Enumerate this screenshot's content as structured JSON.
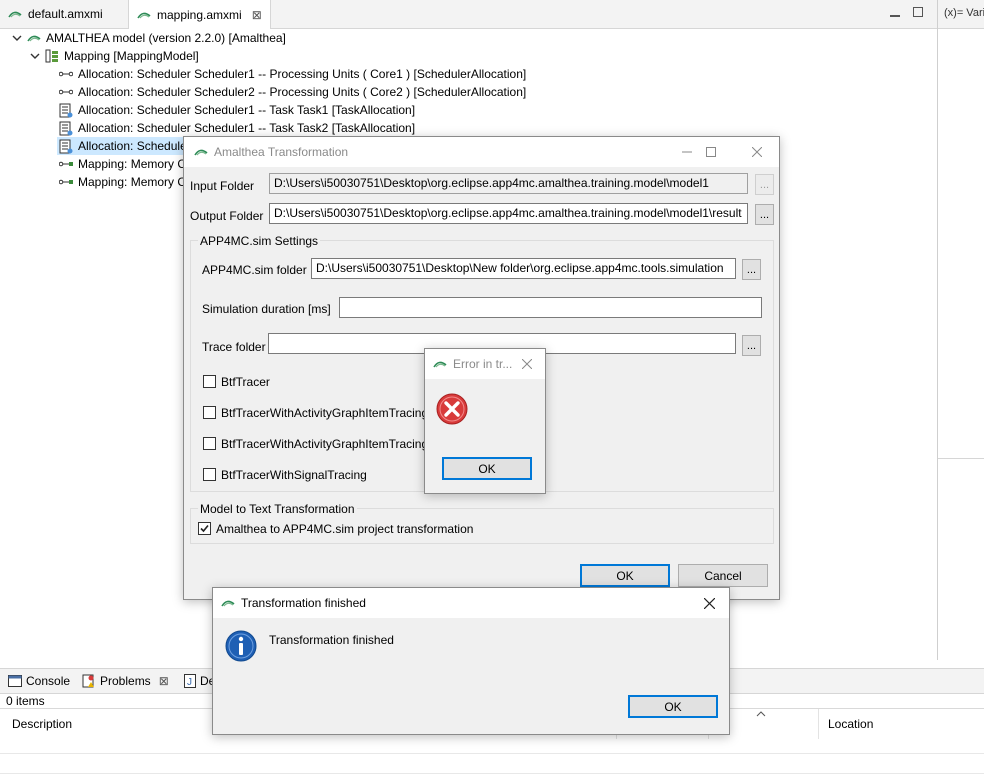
{
  "editor": {
    "tabs": [
      {
        "label": "default.amxmi"
      },
      {
        "label": "mapping.amxmi",
        "close": "⊠"
      }
    ],
    "right_tab_label": "(x)= Varia"
  },
  "tree": {
    "root": "AMALTHEA model (version 2.2.0) [Amalthea]",
    "mapping": "Mapping [MappingModel]",
    "items": [
      {
        "label": "Allocation: Scheduler Scheduler1 -- Processing Units ( Core1 ) [SchedulerAllocation]",
        "icon": "scheduler-allocation-icon"
      },
      {
        "label": "Allocation: Scheduler Scheduler2 -- Processing Units ( Core2 ) [SchedulerAllocation]",
        "icon": "scheduler-allocation-icon"
      },
      {
        "label": "Allocation: Scheduler Scheduler1 -- Task Task1 [TaskAllocation]",
        "icon": "task-allocation-icon"
      },
      {
        "label": "Allocation: Scheduler Scheduler1 -- Task Task2 [TaskAllocation]",
        "icon": "task-allocation-icon"
      },
      {
        "label": "Allocation: Schedule",
        "icon": "task-allocation-icon"
      },
      {
        "label": "Mapping: Memory C",
        "icon": "memory-mapping-icon"
      },
      {
        "label": "Mapping: Memory C",
        "icon": "memory-mapping-icon"
      }
    ]
  },
  "bottom_panel": {
    "tabs": [
      {
        "label": "Console"
      },
      {
        "label": "Problems",
        "close": "⊠"
      },
      {
        "label": "De"
      }
    ],
    "items_count": "0 items",
    "columns": [
      "Description",
      "Location"
    ]
  },
  "transformation_dialog": {
    "title": "Amalthea Transformation",
    "input_folder_label": "Input Folder",
    "input_folder_value": "D:\\Users\\i50030751\\Desktop\\org.eclipse.app4mc.amalthea.training.model\\model1",
    "output_folder_label": "Output Folder",
    "output_folder_value": "D:\\Users\\i50030751\\Desktop\\org.eclipse.app4mc.amalthea.training.model\\model1\\result",
    "browse_label": "...",
    "sim_group_title": "APP4MC.sim Settings",
    "sim_folder_label": "APP4MC.sim folder",
    "sim_folder_value": "D:\\Users\\i50030751\\Desktop\\New folder\\org.eclipse.app4mc.tools.simulation",
    "duration_label": "Simulation duration [ms]",
    "duration_value": "",
    "trace_folder_label": "Trace folder",
    "trace_folder_value": "",
    "tracers": [
      {
        "label": "BtfTracer",
        "checked": false
      },
      {
        "label": "BtfTracerWithActivityGraphItemTracing",
        "checked": false
      },
      {
        "label": "BtfTracerWithActivityGraphItemTracing",
        "checked": false
      },
      {
        "label": "BtfTracerWithSignalTracing",
        "checked": false
      }
    ],
    "m2t_group_title": "Model to Text Transformation",
    "m2t_option_label": "Amalthea to APP4MC.sim project transformation",
    "m2t_option_checked": true,
    "ok_label": "OK",
    "cancel_label": "Cancel"
  },
  "error_dialog": {
    "title": "Error in tr...",
    "ok_label": "OK",
    "icon": "error-icon"
  },
  "finished_dialog": {
    "title": "Transformation finished",
    "message": "Transformation finished",
    "ok_label": "OK",
    "icon": "info-icon"
  },
  "colors": {
    "accent": "#0078d7",
    "error_red": "#d83b3b",
    "info_blue": "#1e5fb4"
  }
}
